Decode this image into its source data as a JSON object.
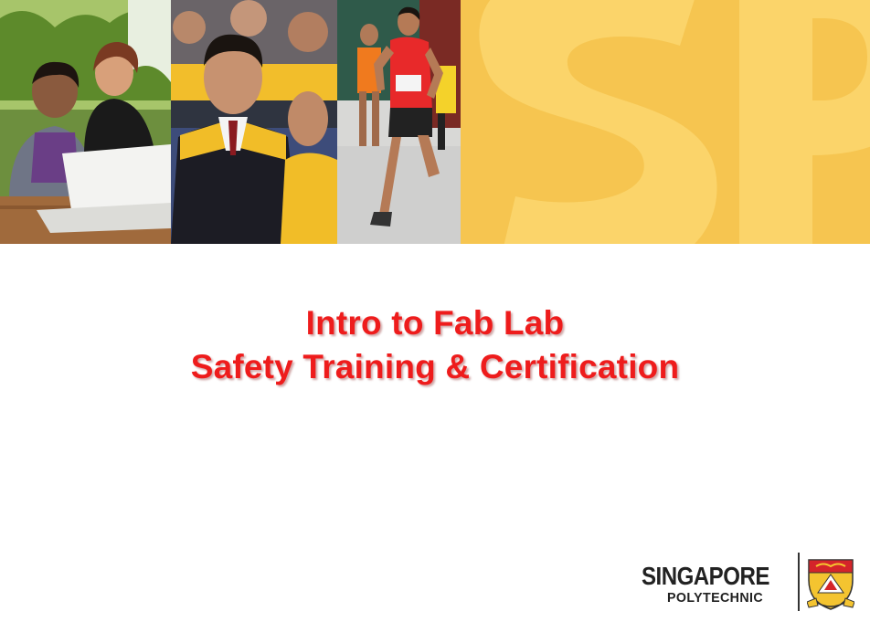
{
  "slide": {
    "title_line1": "Intro to Fab Lab",
    "title_line2": "Safety Training & Certification"
  },
  "banner": {
    "photos": [
      "students-with-laptop",
      "graduate-in-gown",
      "runner-in-race"
    ],
    "panel_letters": "SP"
  },
  "logo": {
    "name": "SINGAPORE",
    "subname": "POLYTECHNIC",
    "emblem": "crest-icon"
  },
  "colors": {
    "title_red": "#ee1c1c",
    "banner_yellow": "#f6c550",
    "letters_yellow": "#fbd56b",
    "logo_text": "#222222"
  }
}
